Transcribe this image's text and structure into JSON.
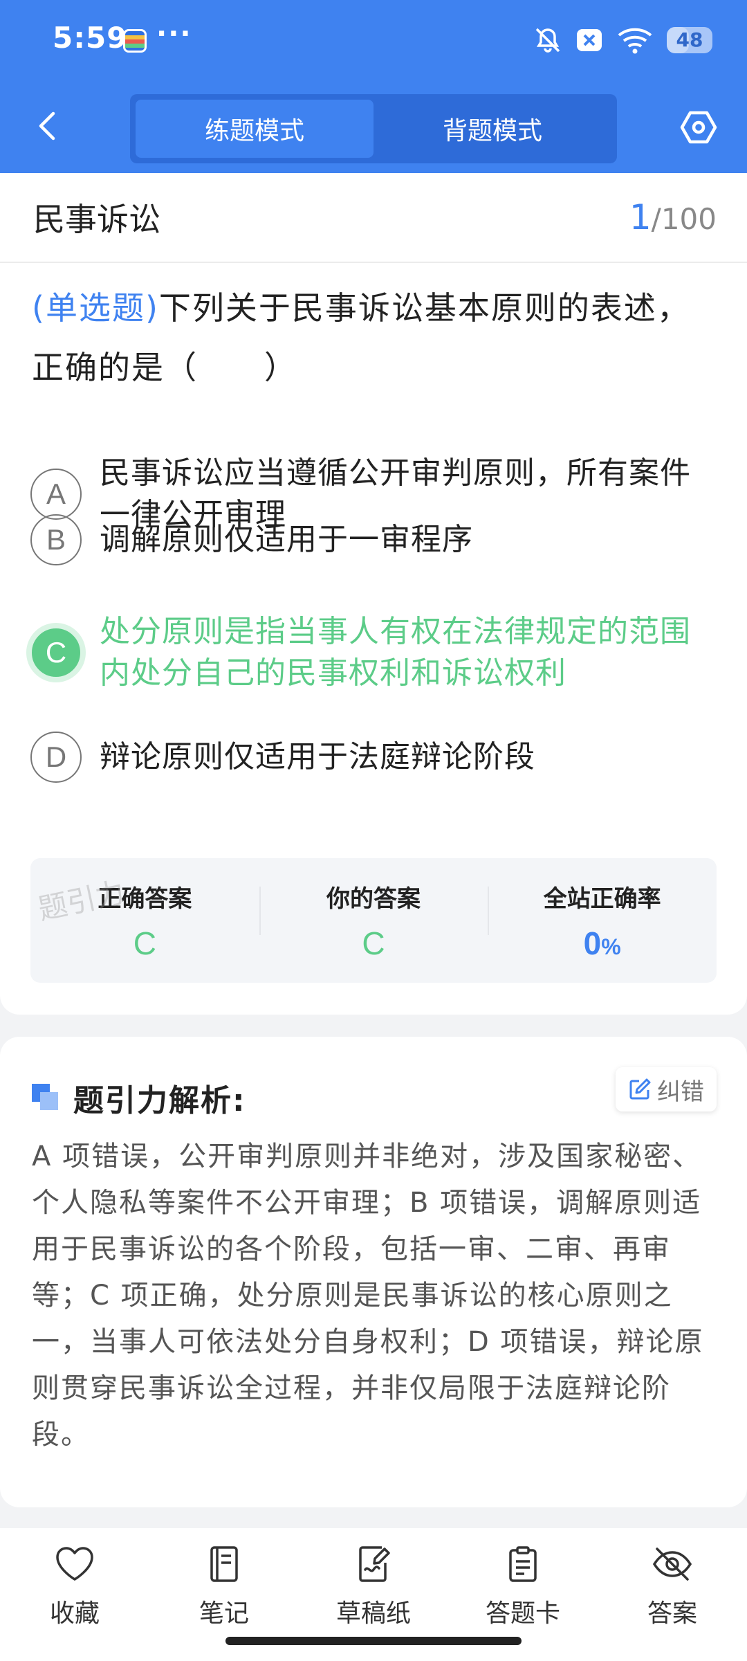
{
  "status_bar": {
    "time": "5:59",
    "more": "···",
    "battery_level": "48",
    "icons": [
      "wallet-app-icon",
      "mute-icon",
      "close-box-icon",
      "wifi-icon",
      "battery-icon"
    ]
  },
  "nav": {
    "back_icon": "chevron-left-icon",
    "modes": [
      "练题模式",
      "背题模式"
    ],
    "active_mode": "练题模式",
    "settings_icon": "hexagon-settings-icon"
  },
  "question": {
    "subject": "民事诉讼",
    "current": "1",
    "total": "/100",
    "type": "(单选题)",
    "text": "下列关于民事诉讼基本原则的表述，正确的是（　　）",
    "options": [
      {
        "letter": "A",
        "text": "民事诉讼应当遵循公开审判原则，所有案件一律公开审理"
      },
      {
        "letter": "B",
        "text": "调解原则仅适用于一审程序"
      },
      {
        "letter": "C",
        "text": "处分原则是指当事人有权在法律规定的范围内处分自己的民事权利和诉讼权利"
      },
      {
        "letter": "D",
        "text": "辩论原则仅适用于法庭辩论阶段"
      }
    ],
    "selected": "C"
  },
  "answer_summary": {
    "watermark": "题引力",
    "correct_label": "正确答案",
    "correct_value": "C",
    "yours_label": "你的答案",
    "yours_value": "C",
    "rate_label": "全站正确率",
    "rate_value": "0",
    "rate_unit": "%"
  },
  "analysis": {
    "title": "题引力解析:",
    "report_label": "纠错",
    "report_icon": "edit-icon",
    "text": "A 项错误，公开审判原则并非绝对，涉及国家秘密、个人隐私等案件不公开审理；B 项错误，调解原则适用于民事诉讼的各个阶段，包括一审、二审、再审等；C 项正确，处分原则是民事诉讼的核心原则之一，当事人可依法处分自身权利；D 项错误，辩论原则贯穿民事诉讼全过程，并非仅局限于法庭辩论阶段。"
  },
  "toolbar": {
    "items": [
      {
        "label": "收藏",
        "icon": "heart-icon"
      },
      {
        "label": "笔记",
        "icon": "notebook-icon"
      },
      {
        "label": "草稿纸",
        "icon": "draft-paper-icon"
      },
      {
        "label": "答题卡",
        "icon": "answer-card-icon"
      },
      {
        "label": "答案",
        "icon": "eye-off-icon"
      }
    ]
  },
  "colors": {
    "primary": "#3f82f0",
    "correct": "#5ccc88",
    "background": "#f2f3f5"
  }
}
